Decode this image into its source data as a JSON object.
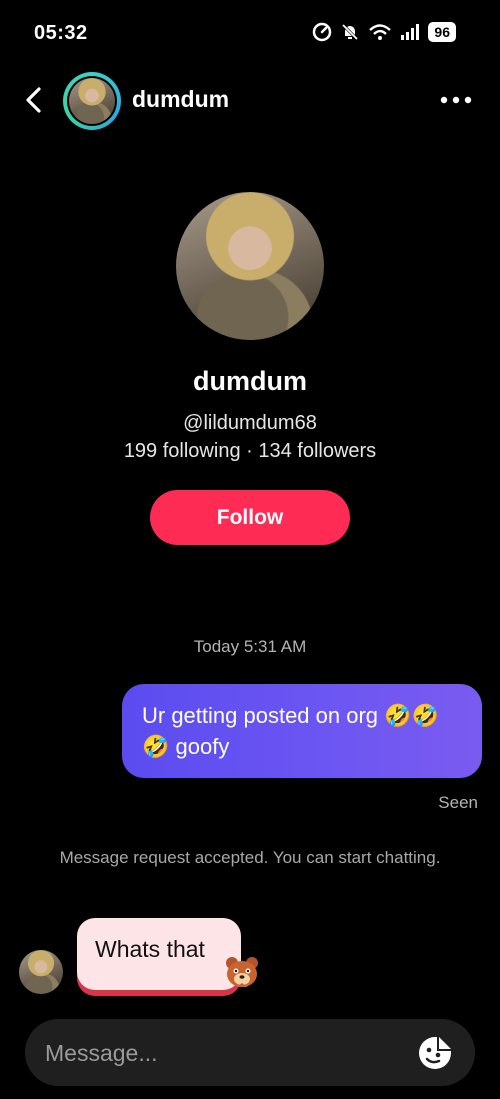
{
  "status_bar": {
    "time": "05:32",
    "battery": "96",
    "icons": [
      "data-saver-icon",
      "mute-icon",
      "wifi-icon",
      "signal-icon",
      "battery-icon"
    ]
  },
  "header": {
    "name": "dumdum",
    "back_icon": "chevron-left-icon",
    "more_icon": "more-horizontal-icon"
  },
  "profile": {
    "name": "dumdum",
    "handle": "@lildumdum68",
    "stats": "199 following · 134 followers",
    "follow_label": "Follow"
  },
  "messages": {
    "timestamp": "Today 5:31 AM",
    "sent_text": "Ur getting posted on org 🤣🤣🤣 goofy",
    "seen_label": "Seen",
    "system_text": "Message request accepted. You can start chatting.",
    "received_text": "Whats that"
  },
  "composer": {
    "placeholder": "Message..."
  },
  "colors": {
    "follow_button": "#fe2c55",
    "sent_bubble": "#5b4cf0",
    "received_bubble": "#fce4e7",
    "avatar_ring": "#3ad1c9"
  }
}
